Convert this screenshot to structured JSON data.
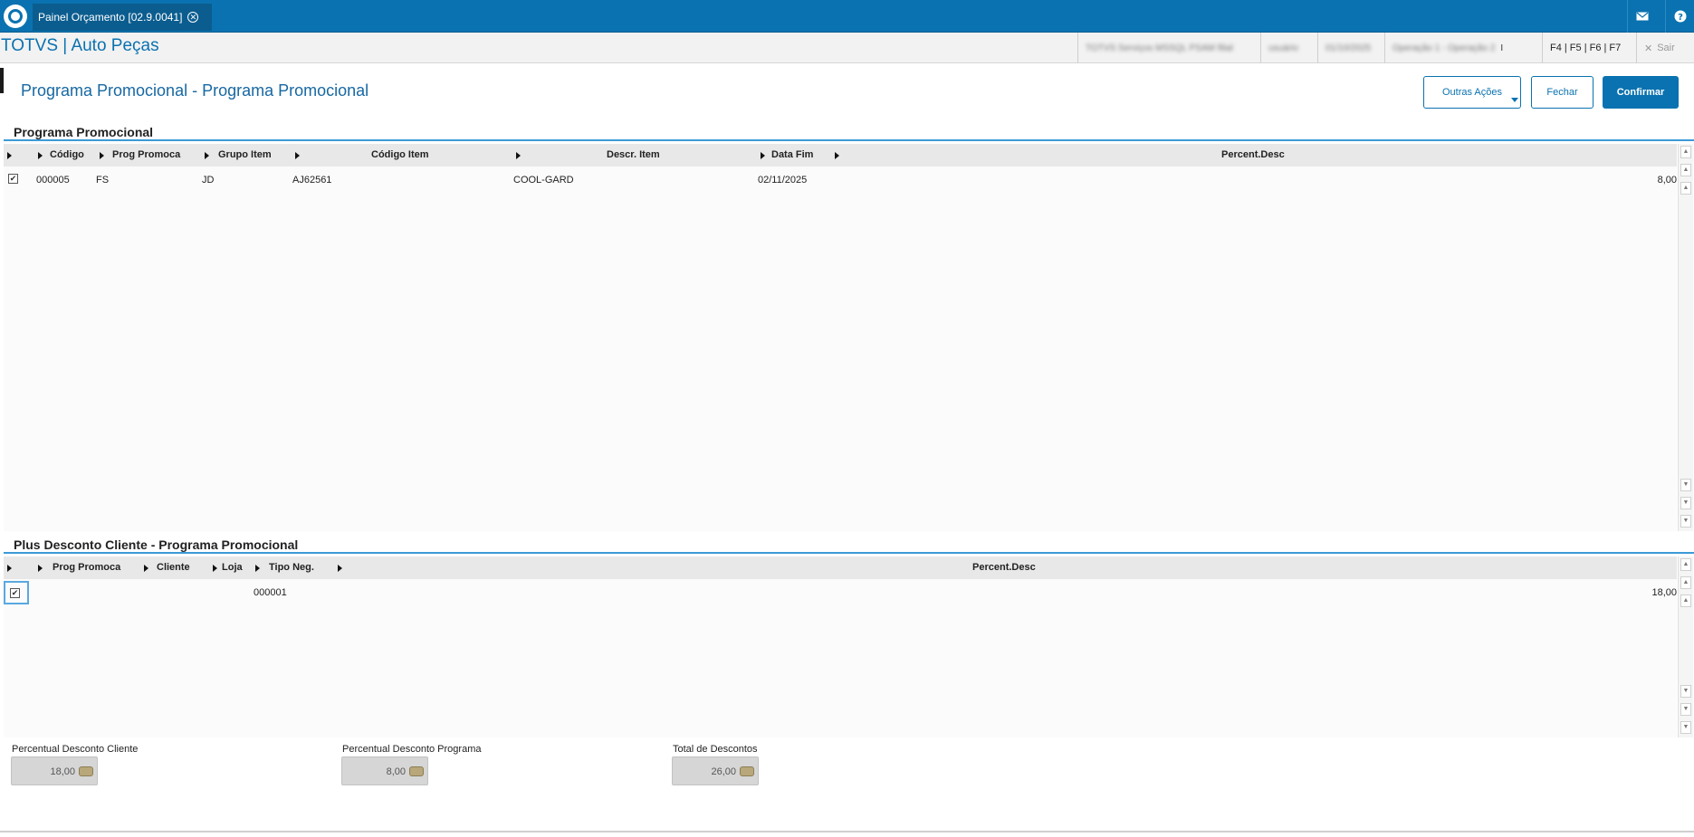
{
  "window": {
    "tab_title": "Painel Orçamento [02.9.0041]",
    "tab_close": "✕",
    "mail_icon": "mail-icon",
    "help_icon": "help-icon"
  },
  "app": {
    "title": "TOTVS | Auto Peças",
    "header_blur_1": "TOTVS Serviços MSSQL PSAM filial",
    "header_blur_2": "usuário",
    "header_blur_3": "01/10/2025",
    "header_blur_4": "Operação 1 - Operação 2",
    "header_sep": "I",
    "shortcut_keys": "F4 | F5 | F6 | F7",
    "exit_label": "Sair",
    "exit_icon": "✕"
  },
  "form": {
    "title": "Programa Promocional - Programa Promocional",
    "btn_other": "Outras Ações",
    "btn_close": "Fechar",
    "btn_confirm": "Confirmar"
  },
  "grid1": {
    "section_title": "Programa Promocional",
    "columns": [
      "Código",
      "Prog Promoca",
      "Grupo Item",
      "Código Item",
      "Descr. Item",
      "Data Fim",
      "Percent.Desc"
    ],
    "rows": [
      {
        "check": "✔",
        "codigo": "000005",
        "prog": "FS",
        "grupo": "JD",
        "codigo_item": "AJ62561",
        "descr": "COOL-GARD",
        "data_fim": "02/11/2025",
        "percent": "8,00"
      }
    ]
  },
  "grid2": {
    "section_title": "Plus Desconto Cliente - Programa Promocional",
    "columns": [
      "Prog Promoca",
      "Cliente",
      "Loja",
      "Tipo Neg.",
      "Percent.Desc"
    ],
    "rows": [
      {
        "check": "✔",
        "tipo_neg": "000001",
        "percent": "18,00"
      }
    ]
  },
  "scroll": {
    "up": "▲",
    "down": "▼"
  },
  "totals": {
    "cliente_label": "Percentual Desconto Cliente",
    "cliente_value": "18,00",
    "programa_label": "Percentual Desconto Programa",
    "programa_value": "8,00",
    "total_label": "Total de Descontos",
    "total_value": "26,00"
  },
  "colors": {
    "brand": "#0a72b0",
    "accent_line": "#3c9ad6"
  }
}
